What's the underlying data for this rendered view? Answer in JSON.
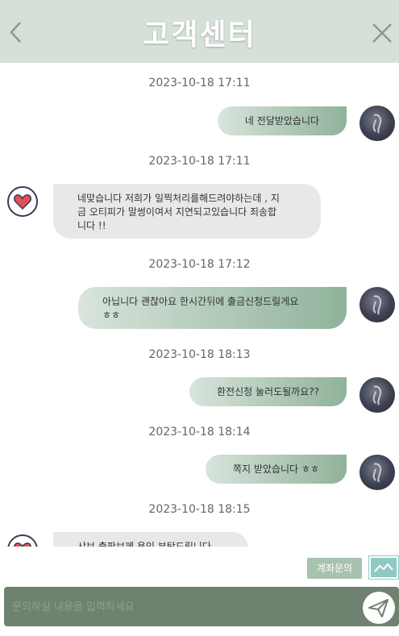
{
  "header": {
    "title": "고객센터",
    "back_icon": "chevron-left-icon",
    "close_icon": "close-icon"
  },
  "messages": [
    {
      "time": "2023-10-18 17:11",
      "from": "agent",
      "lines": [
        "네 전달받았습니다"
      ]
    },
    {
      "time": "2023-10-18 17:11",
      "from": "support",
      "lines": [
        "네맞습니다 저희가 일찍처리를해드려야하는데 , 지",
        "금 오티피가 말썽이여서 지연되고있습니다 죄송합",
        "니다 !!"
      ]
    },
    {
      "time": "2023-10-18 17:12",
      "from": "agent",
      "lines": [
        "아닙니다 괜찮아요 한시간뒤에 출금신청드릴게요",
        "ㅎㅎ"
      ]
    },
    {
      "time": "2023-10-18 18:13",
      "from": "agent",
      "lines": [
        "환전신청 눌러도될까요??"
      ]
    },
    {
      "time": "2023-10-18 18:14",
      "from": "agent",
      "lines": [
        "쪽지 받았습니다 ㅎㅎ"
      ]
    },
    {
      "time": "2023-10-18 18:15",
      "from": "support",
      "lines": [
        "샤브 출판보께 용인 부탁드립니다"
      ]
    }
  ],
  "bottom": {
    "account_button": "계좌문의",
    "image_icon": "image-upload-icon",
    "input_placeholder": "문의하실 내용을 입력하세요",
    "send_icon": "paper-plane-icon"
  },
  "colors": {
    "header_bg": "#d5e0d9",
    "bubble_out_start": "#d8e4dc",
    "bubble_out_end": "#8fb29a",
    "bubble_in": "#e8e8e8",
    "input_bar": "#6f826f"
  }
}
